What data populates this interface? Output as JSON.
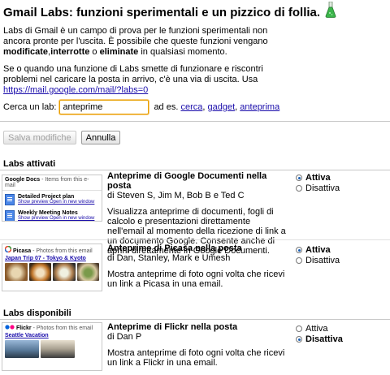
{
  "header": {
    "title": "Gmail Labs: funzioni sperimentali e un pizzico di follia."
  },
  "intro": {
    "p1_a": "Labs di Gmail è un campo di prova per le funzioni sperimentali non ancora pronte per l'uscita. È possibile che queste funzioni vengano ",
    "p1_b1": "modificate",
    "p1_sep1": ",",
    "p1_b2": "interrotte",
    "p1_sep2": " o ",
    "p1_b3": "eliminate",
    "p1_c": " in qualsiasi momento.",
    "p2_a": "Se o quando una funzione di Labs smette di funzionare e riscontri problemi nel caricare la posta in arrivo, c'è una via di uscita. Usa ",
    "p2_link": "https://mail.google.com/mail/?labs=0"
  },
  "search": {
    "label": "Cerca un lab:",
    "value": "anteprime",
    "examples_prefix": "ad es.",
    "examples": [
      "cerca",
      "gadget",
      "anteprima"
    ]
  },
  "buttons": {
    "save": "Salva modifiche",
    "cancel": "Annulla"
  },
  "sections": {
    "enabled": "Labs attivati",
    "available": "Labs disponibili"
  },
  "labs": [
    {
      "name": "Anteprime di Google Documenti nella posta",
      "authors": "di Steven S, Jim M, Bob B e Ted C",
      "description": "Visualizza anteprime di documenti, fogli di calcolo e presentazioni direttamente nell'email al momento della ricezione di link a un documento Google. Consente anche di aprirli direttamente in Google Documenti.",
      "enable": "Attiva",
      "disable": "Disattiva",
      "state": "enabled",
      "thumb": {
        "service": "Google Docs",
        "subtitle": "- Items from this e-mail",
        "items": [
          {
            "title": "Detailed Project plan",
            "links": "Show preview   Open in new window"
          },
          {
            "title": "Weekly Meeting Notes",
            "links": "Show preview   Open in new window"
          }
        ]
      }
    },
    {
      "name": "Anteprime di Picasa nella posta",
      "authors": "di Dan, Stanley, Mark e Umesh",
      "description": "Mostra anteprime di foto ogni volta che ricevi un link a Picasa in una email.",
      "enable": "Attiva",
      "disable": "Disattiva",
      "state": "enabled",
      "thumb": {
        "service": "Picasa",
        "subtitle": "- Photos from this email",
        "album": "Japan Trip 07 - Tokyo & Kyoto"
      }
    },
    {
      "name": "Anteprime di Flickr nella posta",
      "authors": "di Dan P",
      "description": "Mostra anteprime di foto ogni volta che ricevi un link a Flickr in una email.",
      "enable": "Attiva",
      "disable": "Disattiva",
      "state": "disabled",
      "thumb": {
        "service": "Flickr",
        "subtitle": "- Photos from this email",
        "album": "Seattle Vacation"
      }
    }
  ],
  "colors": {
    "link": "#1a0dab",
    "input_focus": "#e8a000",
    "flask_green": "#3bb54a"
  },
  "icons": {
    "flask": "labs-flask-icon",
    "docs": "document-icon",
    "picasa": "picasa-logo-icon",
    "flickr": "flickr-logo-icon"
  }
}
